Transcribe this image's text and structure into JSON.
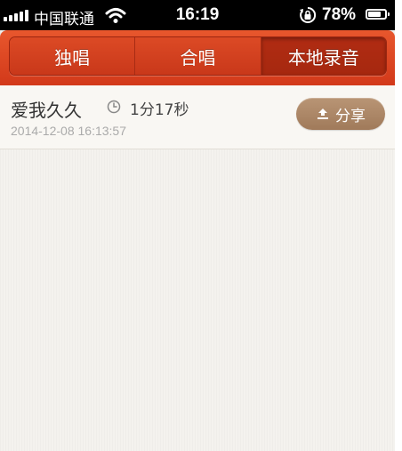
{
  "status_bar": {
    "carrier": "中国联通",
    "time": "16:19",
    "battery_percent": "78%",
    "battery_level": 0.78,
    "signal_bars": 5
  },
  "tabs": [
    {
      "label": "独唱",
      "active": false
    },
    {
      "label": "合唱",
      "active": false
    },
    {
      "label": "本地录音",
      "active": true
    }
  ],
  "recordings": [
    {
      "title": "爱我久久",
      "duration": "1分17秒",
      "date": "2014-12-08 16:13:57",
      "share_label": "分享"
    }
  ],
  "colors": {
    "header": "#d9431f",
    "share_button": "#ab8565",
    "background": "#f4f2ee"
  },
  "icons": {
    "signal": "signal-bars-icon",
    "wifi": "wifi-icon",
    "rotation_lock": "rotation-lock-icon",
    "battery": "battery-icon",
    "clock": "clock-icon",
    "upload": "upload-icon"
  }
}
